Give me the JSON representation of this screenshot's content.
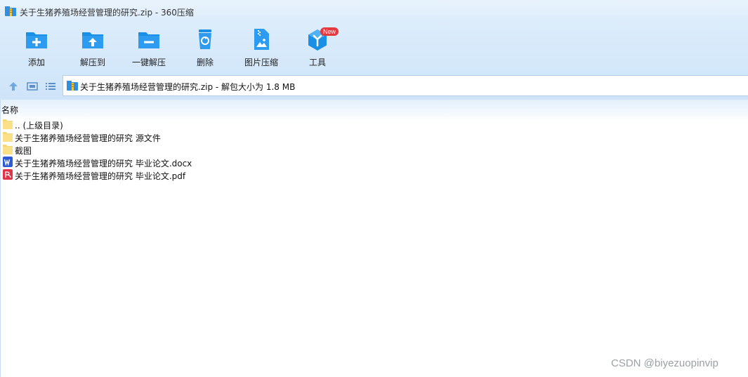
{
  "window": {
    "title": "关于生猪养殖场经营管理的研究.zip - 360压缩"
  },
  "toolbar": {
    "add_label": "添加",
    "extract_to_label": "解压到",
    "one_click_extract_label": "一键解压",
    "delete_label": "删除",
    "image_compress_label": "图片压缩",
    "tools_label": "工具",
    "tools_badge": "New"
  },
  "address": {
    "path_text": "关于生猪养殖场经营管理的研究.zip - 解包大小为 1.8 MB"
  },
  "file_list": {
    "column_name": "名称",
    "items": [
      {
        "name": ".. (上级目录)",
        "icon": "folder-icon"
      },
      {
        "name": "关于生猪养殖场经营管理的研究 源文件",
        "icon": "folder-icon"
      },
      {
        "name": "截图",
        "icon": "folder-icon"
      },
      {
        "name": "关于生猪养殖场经营管理的研究 毕业论文.docx",
        "icon": "word-icon"
      },
      {
        "name": "关于生猪养殖场经营管理的研究 毕业论文.pdf",
        "icon": "pdf-icon"
      }
    ]
  },
  "watermark": "CSDN @biyezuopinvip",
  "colors": {
    "accent": "#1a8fe6",
    "toolbar_bg": "#d7e9fb",
    "badge": "#e5393f",
    "folder": "#f7d774",
    "word": "#2b5bd7",
    "pdf": "#e0344a"
  }
}
